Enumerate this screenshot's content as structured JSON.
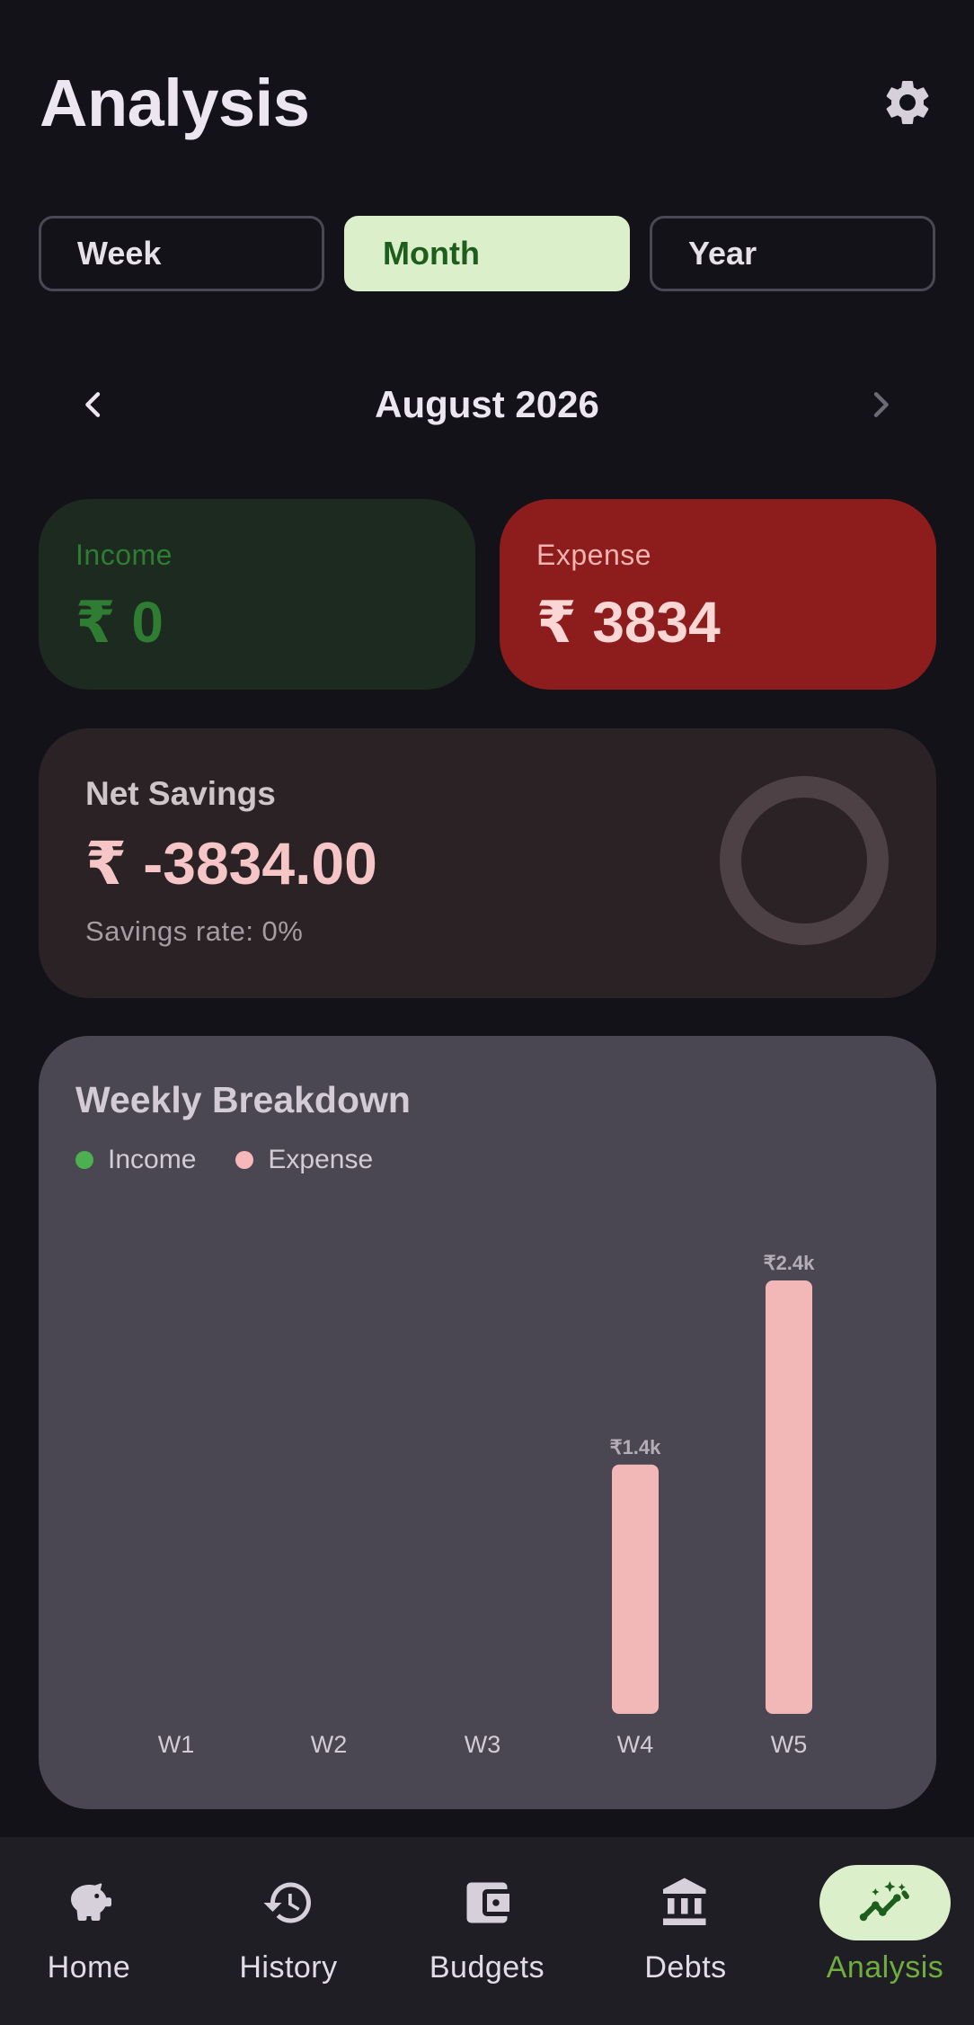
{
  "header": {
    "title": "Analysis"
  },
  "period_tabs": [
    {
      "label": "Week",
      "active": false
    },
    {
      "label": "Month",
      "active": true
    },
    {
      "label": "Year",
      "active": false
    }
  ],
  "period": {
    "label": "August 2026"
  },
  "summary": {
    "income_label": "Income",
    "income_value": "₹ 0",
    "expense_label": "Expense",
    "expense_value": "₹ 3834"
  },
  "net_savings": {
    "label": "Net Savings",
    "value": "₹ -3834.00",
    "rate_text": "Savings rate: 0%",
    "rate_fraction": 0
  },
  "weekly": {
    "title": "Weekly Breakdown",
    "legend": [
      {
        "name": "Income",
        "color": "#4CAF50"
      },
      {
        "name": "Expense",
        "color": "#F6B8B8"
      }
    ]
  },
  "chart_data": {
    "type": "bar",
    "title": "Weekly Breakdown",
    "categories": [
      "W1",
      "W2",
      "W3",
      "W4",
      "W5"
    ],
    "series": [
      {
        "name": "Income",
        "values": [
          0,
          0,
          0,
          0,
          0
        ],
        "color": "#4CAF50"
      },
      {
        "name": "Expense",
        "values": [
          0,
          0,
          0,
          1400,
          2434
        ],
        "color": "#F2B8B8",
        "data_labels": [
          "",
          "",
          "",
          "₹1.4k",
          "₹2.4k"
        ]
      }
    ],
    "ylim": [
      0,
      2434
    ],
    "grid": false,
    "legend": "top-left"
  },
  "bottom_nav": [
    {
      "label": "Home",
      "icon": "piggy-bank-icon",
      "active": false
    },
    {
      "label": "History",
      "icon": "history-icon",
      "active": false
    },
    {
      "label": "Budgets",
      "icon": "wallet-icon",
      "active": false
    },
    {
      "label": "Debts",
      "icon": "bank-icon",
      "active": false
    },
    {
      "label": "Analysis",
      "icon": "analytics-icon",
      "active": true
    }
  ],
  "colors": {
    "background": "#131218",
    "accent_green": "#DCEFCB",
    "expense_red": "#8C1D1C",
    "bar_expense": "#F2B8B8"
  }
}
